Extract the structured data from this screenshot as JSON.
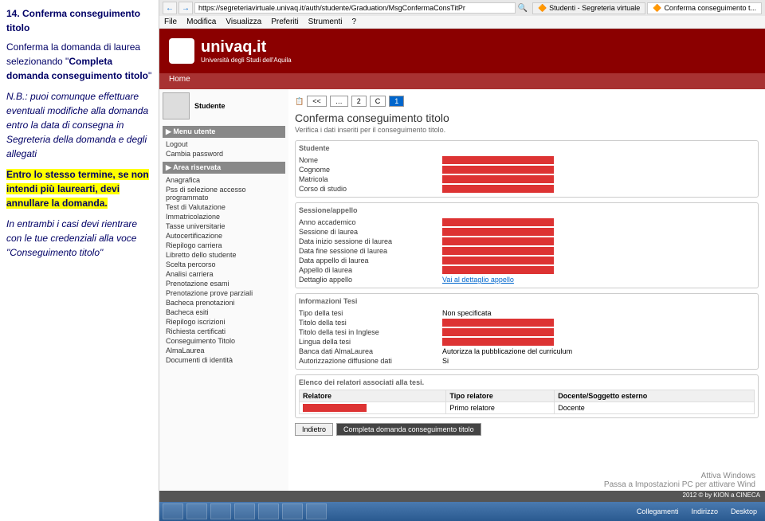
{
  "instruction": {
    "title": "14. Conferma conseguimento titolo",
    "p1": "Conferma la domanda di laurea selezionando \"",
    "p1b": "Completa domanda conseguimento titolo",
    "p1c": "\"",
    "p2a": "N.B.: puoi comunque effettuare eventuali modifiche alla domanda entro la data di consegna in Segreteria della domanda e degli allegati",
    "p3": "Entro lo stesso termine, se non intendi più laurearti, devi annullare la domanda.",
    "p4": "In entrambi i casi devi rientrare con le tue credenziali alla voce \"Conseguimento titolo\""
  },
  "browser": {
    "url": "https://segreteriavirtuale.univaq.it/auth/studente/Graduation/MsgConfermaConsTitPr",
    "tab1": "Studenti - Segreteria virtuale",
    "tab2": "Conferma conseguimento t...",
    "menu": [
      "File",
      "Modifica",
      "Visualizza",
      "Preferiti",
      "Strumenti",
      "?"
    ]
  },
  "brand": {
    "name": "univaq.it",
    "sub": "Università degli Studi dell'Aquila",
    "home": "Home"
  },
  "sidebar": {
    "user": "Studente",
    "menu1": "Menu utente",
    "menu1items": [
      "Logout",
      "Cambia password"
    ],
    "menu2": "Area riservata",
    "menu2items": [
      "Anagrafica",
      "Pss di selezione accesso programmato",
      "Test di Valutazione",
      "Immatricolazione",
      "Tasse universitarie",
      "Autocertificazione",
      "Riepilogo carriera",
      "Libretto dello studente",
      "Scelta percorso",
      "Analisi carriera",
      "Prenotazione esami",
      "Prenotazione prove parziali",
      "Bacheca prenotazioni",
      "Bacheca esiti",
      "Riepilogo iscrizioni",
      "Richiesta certificati",
      "Conseguimento Titolo",
      "AlmaLaurea",
      "Documenti di identità"
    ]
  },
  "content": {
    "breadcrumb": {
      "back": "<<",
      "dots": "…",
      "n2": "2",
      "c": "C",
      "n1": "1"
    },
    "title": "Conferma conseguimento titolo",
    "subtitle": "Verifica i dati inseriti per il conseguimento titolo.",
    "sec1": {
      "title": "Studente",
      "fields": [
        "Nome",
        "Cognome",
        "Matricola",
        "Corso di studio"
      ]
    },
    "sec2": {
      "title": "Sessione/appello",
      "fields": [
        "Anno accademico",
        "Sessione di laurea",
        "Data inizio sessione di laurea",
        "Data fine sessione di laurea",
        "Data appello di laurea",
        "Appello di laurea",
        "Dettaglio appello"
      ],
      "detail": "Vai al dettaglio appello"
    },
    "sec3": {
      "title": "Informazioni Tesi",
      "fields": [
        "Tipo della tesi",
        "Titolo della tesi",
        "Titolo della tesi in Inglese",
        "Lingua della tesi",
        "Banca dati AlmaLaurea",
        "Autorizzazione diffusione dati"
      ],
      "v_tipo": "Non specificata",
      "v_banca": "Autorizza la pubblicazione del curriculum",
      "v_diff": "Si"
    },
    "sec4": {
      "title": "Elenco dei relatori associati alla tesi.",
      "th1": "Relatore",
      "th2": "Tipo relatore",
      "th3": "Docente/Soggetto esterno",
      "td2": "Primo relatore",
      "td3": "Docente"
    },
    "btn_back": "Indietro",
    "btn_submit": "Completa domanda conseguimento titolo",
    "footer": "2012 © by KION a CINECA"
  },
  "taskbar": {
    "coll": "Collegamenti",
    "ind": "Indirizzo",
    "desk": "Desktop"
  },
  "activate": {
    "l1": "Attiva Windows",
    "l2": "Passa a Impostazioni PC per attivare Wind"
  }
}
